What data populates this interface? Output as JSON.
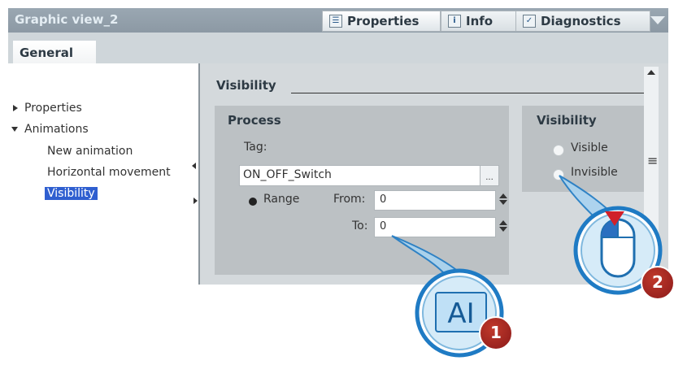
{
  "window": {
    "title": "Graphic view_2"
  },
  "tabs": [
    {
      "label": "Properties",
      "icon": "properties-icon"
    },
    {
      "label": "Info",
      "icon": "info-icon"
    },
    {
      "label": "Diagnostics",
      "icon": "diagnostics-icon"
    }
  ],
  "general_tab": "General",
  "nav": {
    "properties": "Properties",
    "animations": "Animations",
    "new_animation": "New animation",
    "horizontal_movement": "Horizontal movement",
    "visibility": "Visibility"
  },
  "section": {
    "title": "Visibility"
  },
  "process": {
    "title": "Process",
    "tag_label": "Tag:",
    "tag_value": "ON_OFF_Switch",
    "browse": "...",
    "range_label": "Range",
    "from_label": "From:",
    "from_value": "0",
    "to_label": "To:",
    "to_value": "0"
  },
  "visibility_group": {
    "title": "Visibility",
    "visible": "Visible",
    "invisible": "Invisible"
  },
  "callouts": {
    "step1": "1",
    "step2": "2",
    "text_cursor": "AI"
  },
  "colors": {
    "accent_blue": "#1f7bc4",
    "badge_red": "#a52a2a",
    "selection": "#2f5fd0"
  }
}
